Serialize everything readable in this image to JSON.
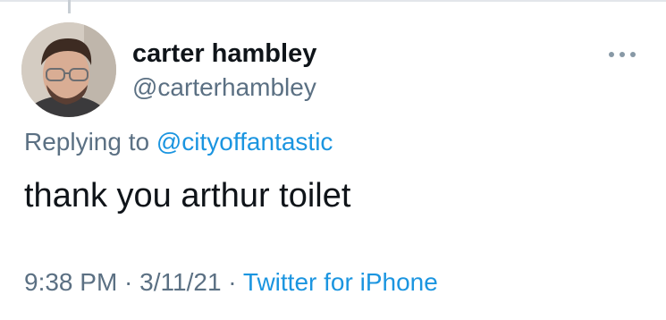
{
  "user": {
    "display_name": "carter hambley",
    "handle": "@carterhambley"
  },
  "reply": {
    "prefix": "Replying to ",
    "mention": "@cityoffantastic"
  },
  "tweet": {
    "text": "thank you arthur toilet"
  },
  "meta": {
    "time": "9:38 PM",
    "separator": " · ",
    "date": "3/11/21",
    "source": "Twitter for iPhone"
  },
  "icons": {
    "avatar": "profile-photo",
    "more": "more-options-icon"
  },
  "colors": {
    "link": "#1b95e0",
    "secondary_text": "#5b7083",
    "primary_text": "#0f1419"
  }
}
